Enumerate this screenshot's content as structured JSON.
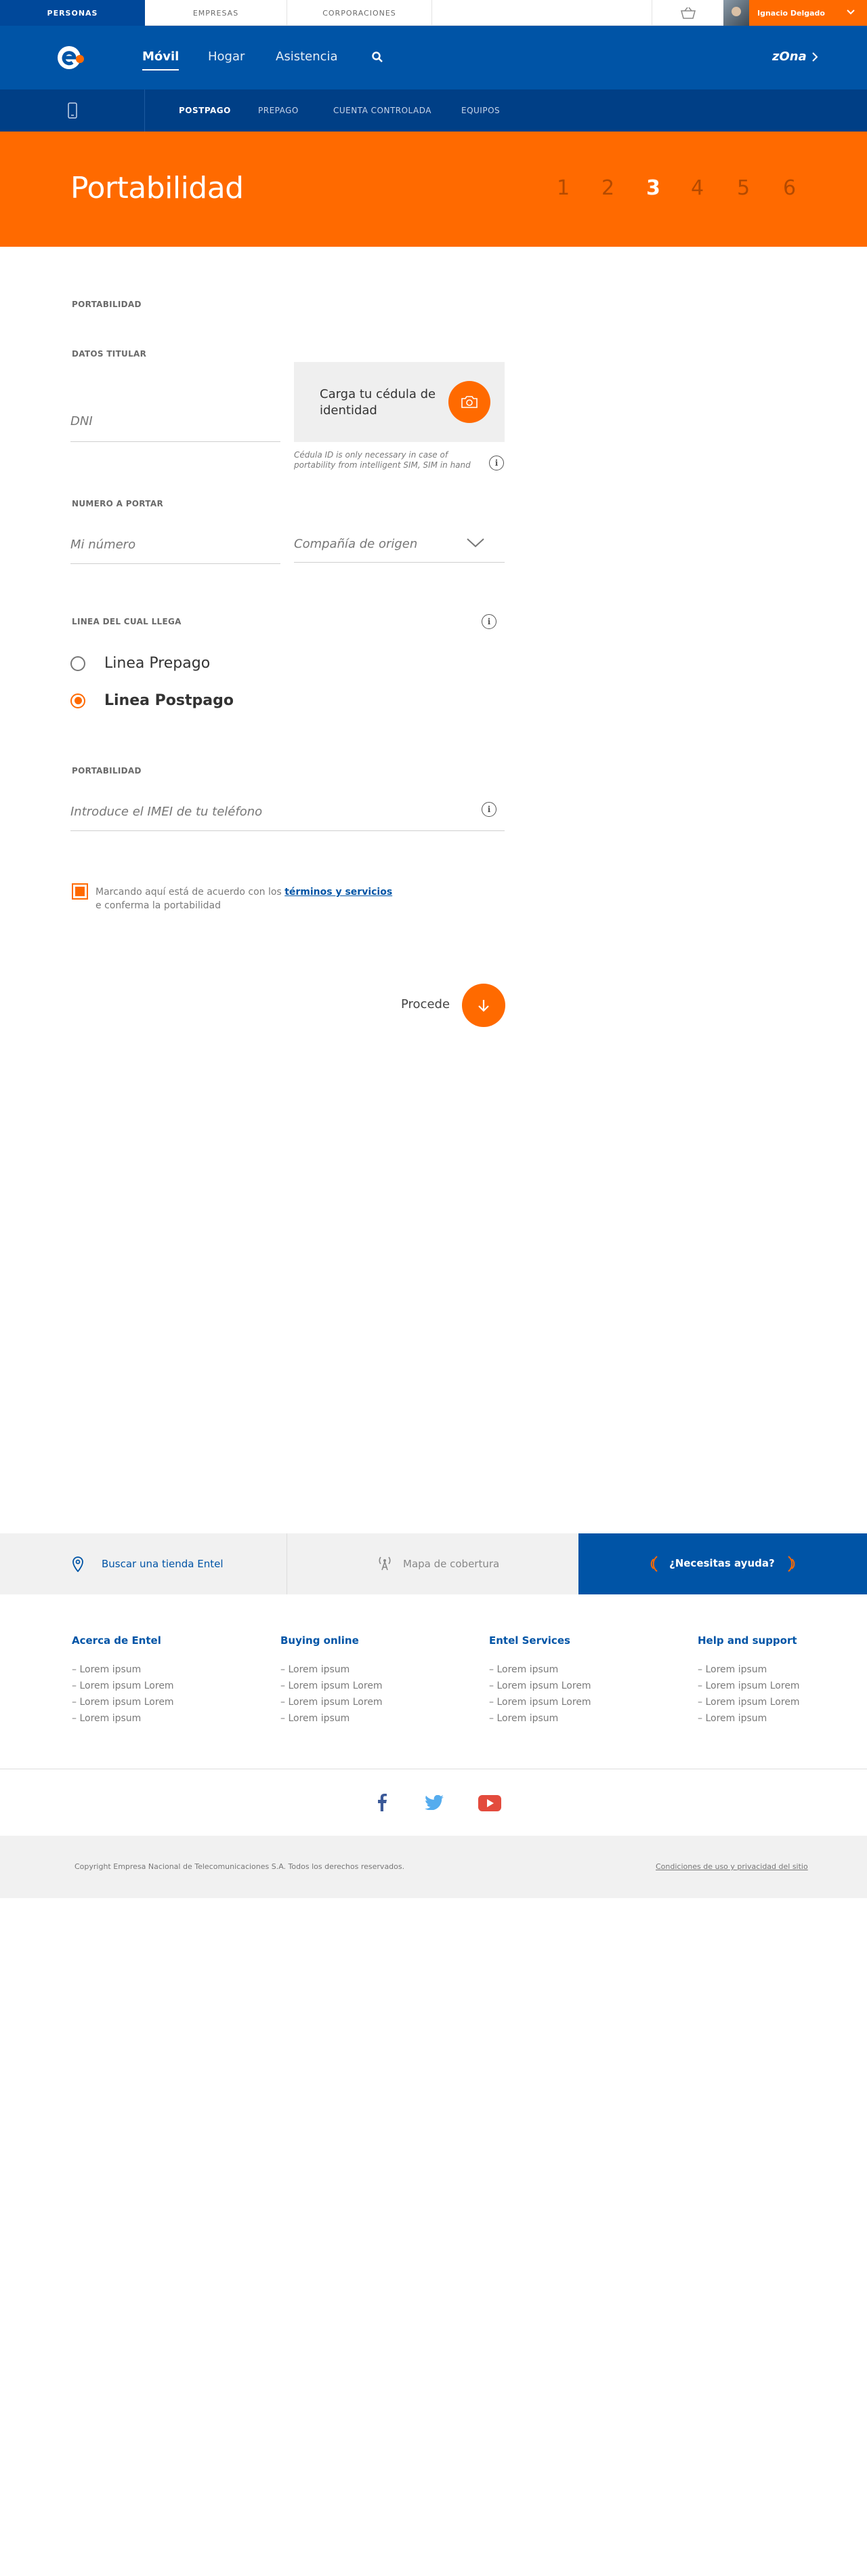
{
  "topbar": {
    "segments": [
      "PERSONAS",
      "EMPRESAS",
      "CORPORACIONES"
    ],
    "user_name": "Ignacio Delgado"
  },
  "mainnav": {
    "links": [
      "Móvil",
      "Hogar",
      "Asistencia"
    ],
    "zona": "zOna"
  },
  "subnav": {
    "links": [
      "POSTPAGO",
      "PREPAGO",
      "CUENTA CONTROLADA",
      "EQUIPOS"
    ]
  },
  "hero": {
    "title": "Portabilidad",
    "steps": [
      "1",
      "2",
      "3",
      "4",
      "5",
      "6"
    ],
    "current_step": 3
  },
  "form": {
    "section_portabilidad": "PORTABILIDAD",
    "datos_titular": "DATOS TITULAR",
    "dni_placeholder": "DNI",
    "upload_label": "Carga tu cédula de identidad",
    "upload_note": "Cédula ID is only necessary in case of portability from intelligent SIM, SIM in hand",
    "numero_label": "NUMERO A PORTAR",
    "numero_placeholder": "Mi número",
    "company_select": "Compañía de origen",
    "linea_label": "LINEA DEL CUAL LLEGA",
    "radio_prepago": "Linea Prepago",
    "radio_postpago": "Linea Postpago",
    "selected_line": "Linea Postpago",
    "portabilidad_label": "PORTABILIDAD",
    "imei_placeholder": "Introduce el IMEI de tu teléfono",
    "terms_prefix": "Marcando aquí está de acuerdo con los ",
    "terms_link": "términos y servicios",
    "terms_suffix": "e conferma la portabilidad",
    "proceed": "Procede"
  },
  "footer": {
    "actions": [
      "Buscar una tienda Entel",
      "Mapa de cobertura",
      "¿Necesitas ayuda?"
    ],
    "columns": [
      {
        "heading": "Acerca de Entel",
        "items": [
          "Lorem ipsum",
          "Lorem ipsum Lorem",
          "Lorem ipsum Lorem",
          "Lorem ipsum"
        ]
      },
      {
        "heading": "Buying online",
        "items": [
          "Lorem ipsum",
          "Lorem ipsum Lorem",
          "Lorem ipsum Lorem",
          "Lorem ipsum"
        ]
      },
      {
        "heading": "Entel Services",
        "items": [
          "Lorem ipsum",
          "Lorem ipsum Lorem",
          "Lorem ipsum Lorem",
          "Lorem ipsum"
        ]
      },
      {
        "heading": "Help and support",
        "items": [
          "Lorem ipsum",
          "Lorem ipsum Lorem",
          "Lorem ipsum Lorem",
          "Lorem ipsum"
        ]
      }
    ],
    "copyright": "Copyright Empresa Nacional de Telecomunicaciones S.A. Todos los derechos reservados.",
    "legal_link": "Condiciones de uso y privacidad del sitio"
  },
  "colors": {
    "brand_blue": "#0054a6",
    "dark_blue": "#003f86",
    "accent_orange": "#ff6a00"
  }
}
